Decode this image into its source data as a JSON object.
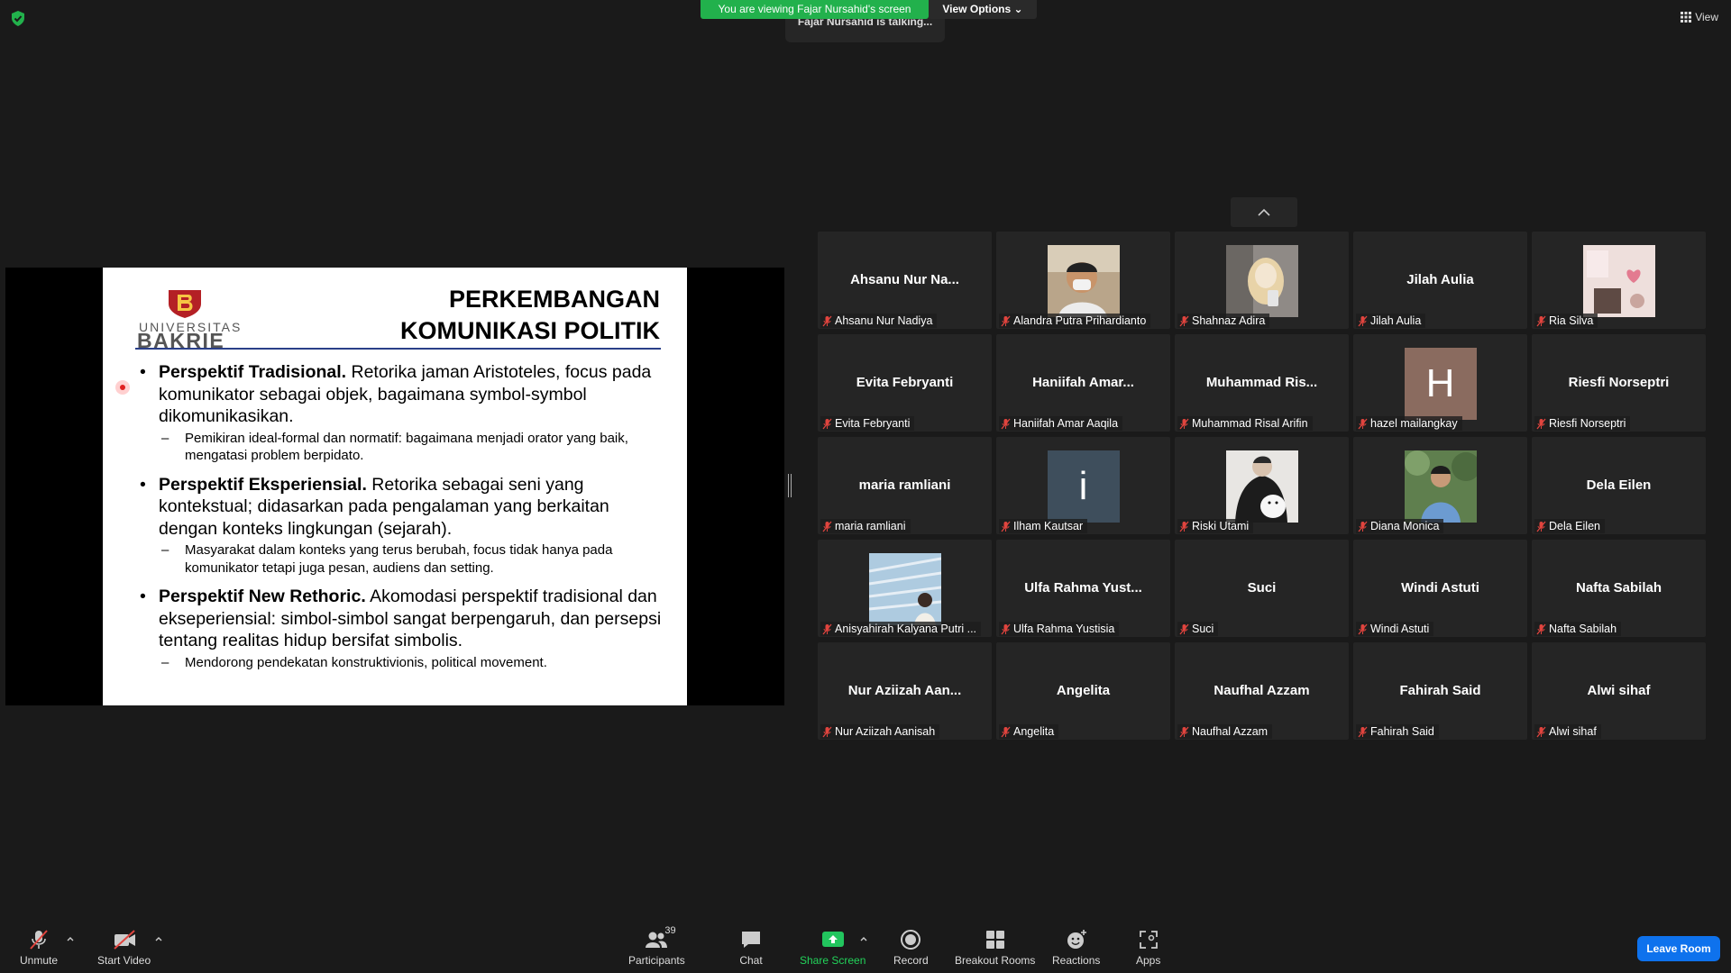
{
  "top": {
    "viewing_banner": "You are viewing Fajar Nursahid's screen",
    "view_options": "View Options",
    "talking": "Fajar Nursahid is talking...",
    "view_button": "View"
  },
  "slide": {
    "logo_top": "UNIVERSITAS",
    "logo_main": "BAKRIE",
    "title_line1": "PERKEMBANGAN",
    "title_line2": "KOMUNIKASI POLITIK",
    "bullets": [
      {
        "heading": "Perspektif Tradisional.",
        "text": " Retorika jaman Aristoteles, focus pada komunikator sebagai objek, bagaimana symbol-symbol dikomunikasikan.",
        "sub": "Pemikiran ideal-formal dan normatif: bagaimana menjadi orator yang baik, mengatasi problem berpidato."
      },
      {
        "heading": "Perspektif Eksperiensial.",
        "text": " Retorika sebagai seni yang kontekstual; didasarkan pada pengalaman yang berkaitan dengan konteks lingkungan (sejarah).",
        "sub": "Masyarakat dalam konteks yang terus berubah, focus tidak hanya pada komunikator tetapi juga pesan, audiens dan setting."
      },
      {
        "heading": "Perspektif New Rethoric.",
        "text": " Akomodasi perspektif tradisional dan ekseperiensial: simbol-simbol sangat berpengaruh, dan persepsi tentang realitas hidup bersifat simbolis.",
        "sub": "Mendorong pendekatan konstruktivionis, political movement."
      }
    ]
  },
  "gallery": {
    "tiles": [
      {
        "center": "Ahsanu Nur Na...",
        "label": "Ahsanu Nur Nadiya"
      },
      {
        "center": "",
        "label": "Alandra Putra Prihardianto"
      },
      {
        "center": "",
        "label": "Shahnaz Adira"
      },
      {
        "center": "Jilah Aulia",
        "label": "Jilah Aulia"
      },
      {
        "center": "",
        "label": "Ria Silva"
      },
      {
        "center": "Evita Febryanti",
        "label": "Evita Febryanti"
      },
      {
        "center": "Haniifah  Amar...",
        "label": "Haniifah Amar Aaqila"
      },
      {
        "center": "Muhammad  Ris...",
        "label": "Muhammad Risal Arifin"
      },
      {
        "center": "H",
        "label": "hazel mailangkay"
      },
      {
        "center": "Riesfi Norseptri",
        "label": "Riesfi Norseptri"
      },
      {
        "center": "maria ramliani",
        "label": "maria ramliani"
      },
      {
        "center": "i",
        "label": "Ilham Kautsar"
      },
      {
        "center": "",
        "label": "Riski Utami"
      },
      {
        "center": "",
        "label": "Diana Monica"
      },
      {
        "center": "Dela Eilen",
        "label": "Dela Eilen"
      },
      {
        "center": "",
        "label": "Anisyahirah Kalyana Putri ..."
      },
      {
        "center": "Ulfa Rahma Yust...",
        "label": "Ulfa Rahma Yustisia"
      },
      {
        "center": "Suci",
        "label": "Suci"
      },
      {
        "center": "Windi Astuti",
        "label": "Windi Astuti"
      },
      {
        "center": "Nafta Sabilah",
        "label": "Nafta Sabilah"
      },
      {
        "center": "Nur  Aziizah  Aan...",
        "label": "Nur Aziizah Aanisah"
      },
      {
        "center": "Angelita",
        "label": "Angelita"
      },
      {
        "center": "Naufhal Azzam",
        "label": "Naufhal Azzam"
      },
      {
        "center": "Fahirah Said",
        "label": "Fahirah Said"
      },
      {
        "center": "Alwi sihaf",
        "label": "Alwi sihaf"
      }
    ]
  },
  "toolbar": {
    "unmute": "Unmute",
    "start_video": "Start Video",
    "participants": "Participants",
    "participants_count": "39",
    "chat": "Chat",
    "share_screen": "Share Screen",
    "record": "Record",
    "breakout_rooms": "Breakout Rooms",
    "reactions": "Reactions",
    "apps": "Apps",
    "leave_room": "Leave Room"
  },
  "colors": {
    "accent_green": "#22b14c",
    "leave_blue": "#0e72ed",
    "mute_red": "#e0443e"
  }
}
